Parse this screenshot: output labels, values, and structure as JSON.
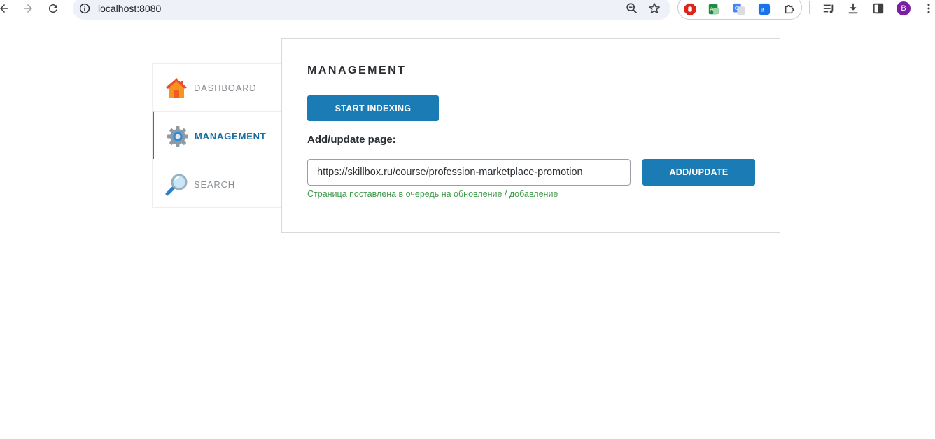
{
  "browser": {
    "url": "localhost:8080",
    "avatar_initial": "B"
  },
  "sidebar": {
    "items": [
      {
        "label": "DASHBOARD",
        "icon": "house-icon",
        "active": false
      },
      {
        "label": "MANAGEMENT",
        "icon": "gear-icon",
        "active": true
      },
      {
        "label": "SEARCH",
        "icon": "magnifier-icon",
        "active": false
      }
    ]
  },
  "main": {
    "title": "MANAGEMENT",
    "start_indexing_label": "START INDEXING",
    "add_page_label": "Add/update page:",
    "url_value": "https://skillbox.ru/course/profession-marketplace-promotion",
    "add_update_label": "ADD/UPDATE",
    "status_message": "Страница поставлена в очередь на обновление / добавление"
  },
  "colors": {
    "accent": "#1a7bb5",
    "success_text": "#3f9a4a",
    "avatar": "#7b1fa2"
  }
}
